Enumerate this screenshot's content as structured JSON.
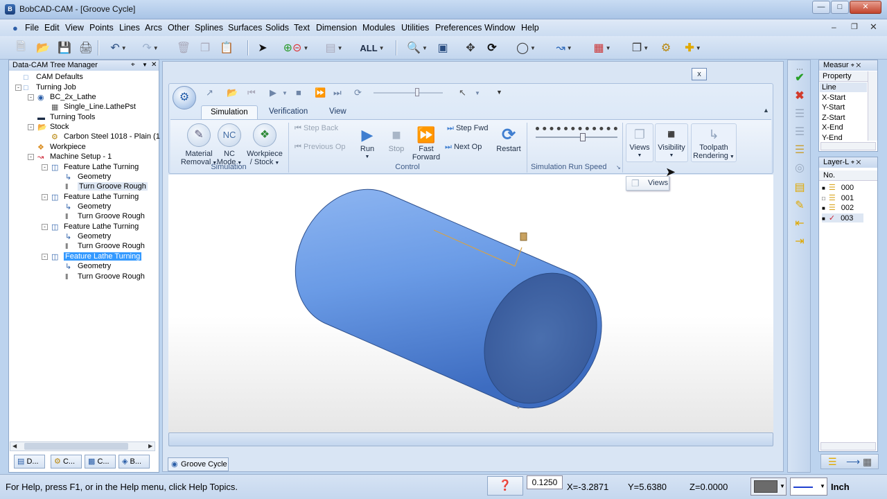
{
  "window": {
    "title": "BobCAD-CAM - [Groove Cycle]"
  },
  "menu": [
    "File",
    "Edit",
    "View",
    "Points",
    "Lines",
    "Arcs",
    "Other",
    "Splines",
    "Surfaces",
    "Solids",
    "Text",
    "Dimension",
    "Modules",
    "Utilities",
    "Preferences",
    "Window",
    "Help"
  ],
  "toolbar": {
    "filter_label": "ALL"
  },
  "tree": {
    "title": "Data-CAM Tree Manager",
    "rows": [
      "CAM Defaults",
      "Turning Job",
      "BC_2x_Lathe",
      "Single_Line.LathePst",
      "Turning Tools",
      "Stock",
      "Carbon Steel 1018 - Plain (1",
      "Workpiece",
      "Machine Setup - 1",
      "Feature Lathe Turning",
      "Geometry",
      "Turn Groove Rough",
      "Feature Lathe Turning",
      "Geometry",
      "Turn Groove Rough",
      "Feature Lathe Turning",
      "Geometry",
      "Turn Groove Rough",
      "Feature Lathe Turning",
      "Geometry",
      "Turn Groove Rough"
    ],
    "selected_row": 18,
    "highlighted_row": 11,
    "bottom_tabs": [
      "D...",
      "C...",
      "C...",
      "B..."
    ]
  },
  "ribbon": {
    "tabs": [
      "Simulation",
      "Verification",
      "View"
    ],
    "active_tab": "Simulation",
    "buttons": {
      "material": [
        "Material",
        "Removal"
      ],
      "nc": [
        "NC",
        "Mode"
      ],
      "workpiece": [
        "Workpiece",
        "/ Stock"
      ],
      "run": "Run",
      "stop": "Stop",
      "fast": [
        "Fast",
        "Forward"
      ],
      "restart": "Restart",
      "views": "Views",
      "visibility": "Visibility",
      "toolpath": [
        "Toolpath",
        "Rendering"
      ]
    },
    "small": {
      "step_back": "Step Back",
      "previous_op": "Previous Op",
      "step_fwd": "Step Fwd",
      "next_op": "Next Op"
    },
    "groups": [
      "Simulation",
      "Control",
      "Simulation Run Speed"
    ],
    "nc_icon_text": "NC"
  },
  "tooltip": "Views",
  "close_label": "x",
  "doc_tab": "Groove Cycle",
  "measure": {
    "title": "Measur",
    "header": "Property",
    "rows": [
      "Line",
      "X-Start",
      "Y-Start",
      "Z-Start",
      "X-End",
      "Y-End"
    ]
  },
  "layers": {
    "title": "Layer-L",
    "col": "No.",
    "rows": [
      "000",
      "001",
      "002",
      "003"
    ]
  },
  "status": {
    "help": "For Help, press F1, or in the Help menu, click Help Topics.",
    "step": "0.1250",
    "x": "X=-3.2871",
    "y": "Y=5.6380",
    "z": "Z=0.0000",
    "units": "Inch"
  },
  "colors": {
    "accent": "#3399ff",
    "cylinder": "#5b8fe0",
    "toolpath": "#d4a24a"
  }
}
